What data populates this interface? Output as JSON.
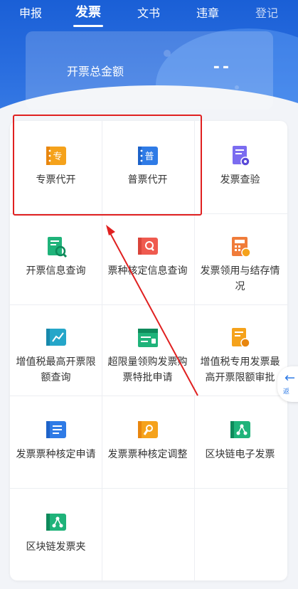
{
  "tabs": [
    {
      "label": "申报"
    },
    {
      "label": "发票"
    },
    {
      "label": "文书"
    },
    {
      "label": "违章"
    },
    {
      "label": "登记"
    }
  ],
  "summary": {
    "label": "开票总金额",
    "value": "--"
  },
  "services": [
    {
      "label": "专票代开",
      "icon": "special-invoice-icon",
      "glyph": "专"
    },
    {
      "label": "普票代开",
      "icon": "ordinary-invoice-icon",
      "glyph": "普"
    },
    {
      "label": "发票查验",
      "icon": "invoice-verify-icon"
    },
    {
      "label": "开票信息查询",
      "icon": "invoice-info-search-icon"
    },
    {
      "label": "票种核定信息查询",
      "icon": "ticket-type-search-icon"
    },
    {
      "label": "发票领用与结存情况",
      "icon": "invoice-calculator-icon"
    },
    {
      "label": "增值税最高开票限额查询",
      "icon": "vat-limit-chart-icon"
    },
    {
      "label": "超限量领购发票购票特批申请",
      "icon": "over-limit-purchase-icon"
    },
    {
      "label": "增值税专用发票最高开票限额审批",
      "icon": "vat-approval-coin-icon"
    },
    {
      "label": "发票票种核定申请",
      "icon": "ticket-type-apply-icon"
    },
    {
      "label": "发票票种核定调整",
      "icon": "ticket-type-adjust-icon"
    },
    {
      "label": "区块链电子发票",
      "icon": "blockchain-invoice-icon"
    },
    {
      "label": "区块链发票夹",
      "icon": "blockchain-folder-icon"
    }
  ],
  "side_tab": {
    "label": "返"
  },
  "colors": {
    "brand_blue": "#2f7be6",
    "orange": "#f5a21b",
    "green": "#1fb37a",
    "purple": "#7b6cf0",
    "red": "#ef5a4f",
    "highlight_red": "#e02020"
  }
}
